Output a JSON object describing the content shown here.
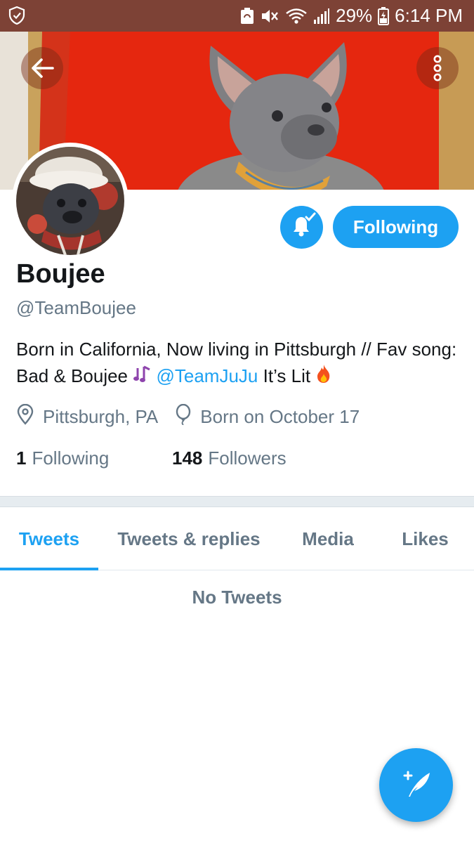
{
  "status_bar": {
    "battery_percent": "29%",
    "time": "6:14 PM",
    "icons": [
      "shield-icon",
      "battery-saver-icon",
      "vibrate-icon",
      "wifi-icon",
      "signal-icon",
      "battery-icon"
    ]
  },
  "header": {
    "back_icon": "arrow-left-icon",
    "more_icon": "more-vertical-icon"
  },
  "profile": {
    "display_name": "Boujee",
    "handle": "@TeamBoujee",
    "bio_text": "Born in California, Now living in Pittsburgh // Fav song: Bad & Boujee",
    "bio_emoji_1": "🎶",
    "bio_mention": "@TeamJuJu",
    "bio_tail": "It’s Lit",
    "bio_emoji_2": "🔥",
    "location": "Pittsburgh, PA",
    "birthday": "Born on October 17",
    "following_count": "1",
    "following_label": "Following",
    "followers_count": "148",
    "followers_label": "Followers"
  },
  "actions": {
    "notifications_icon": "bell-check-icon",
    "follow_button_label": "Following"
  },
  "tabs": [
    {
      "label": "Tweets",
      "active": true
    },
    {
      "label": "Tweets & replies",
      "active": false
    },
    {
      "label": "Media",
      "active": false
    },
    {
      "label": "Likes",
      "active": false
    }
  ],
  "empty_state": "No Tweets",
  "fab": {
    "icon": "compose-feather-icon"
  },
  "colors": {
    "accent": "#1da1f2",
    "status_bar": "#7d4236",
    "secondary_text": "#657786",
    "primary_text": "#14171a"
  }
}
